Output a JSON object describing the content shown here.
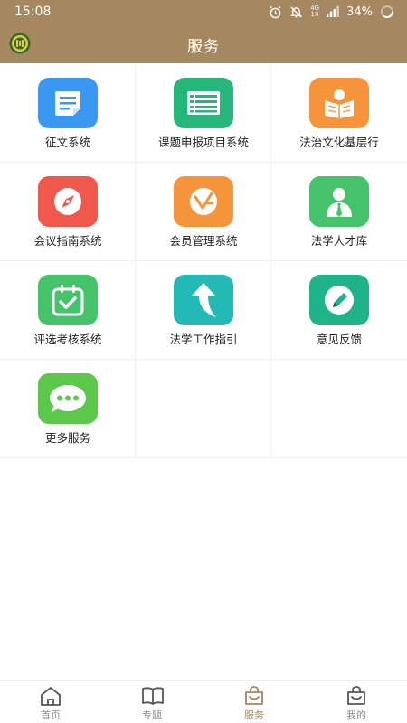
{
  "status": {
    "time": "15:08",
    "battery": "34%",
    "network_top": "4G",
    "network_bottom": "1X"
  },
  "header": {
    "title": "服务",
    "logo_icon": "emblem-logo-icon"
  },
  "colors": {
    "header": "#a58760",
    "tab_active": "#a58760",
    "tab_inactive": "#8a8a8a"
  },
  "services": [
    {
      "label": "征文系统",
      "icon": "document-icon",
      "color": "#3a97f2"
    },
    {
      "label": "课题申报项目系统",
      "icon": "list-icon",
      "color": "#25b67a"
    },
    {
      "label": "法治文化基层行",
      "icon": "reading-icon",
      "color": "#f5943a"
    },
    {
      "label": "会议指南系统",
      "icon": "compass-icon",
      "color": "#f0584b"
    },
    {
      "label": "会员管理系统",
      "icon": "member-icon",
      "color": "#f5943a"
    },
    {
      "label": "法学人才库",
      "icon": "person-icon",
      "color": "#45c36b"
    },
    {
      "label": "评选考核系统",
      "icon": "calendar-check-icon",
      "color": "#45c36b"
    },
    {
      "label": "法学工作指引",
      "icon": "arrow-up-icon",
      "color": "#23bab6"
    },
    {
      "label": "意见反馈",
      "icon": "pencil-icon",
      "color": "#1fb389"
    },
    {
      "label": "更多服务",
      "icon": "more-icon",
      "color": "#5cc84a"
    }
  ],
  "tabs": [
    {
      "label": "首页",
      "icon": "home-icon"
    },
    {
      "label": "专题",
      "icon": "book-icon"
    },
    {
      "label": "服务",
      "icon": "bag-icon",
      "active": true
    },
    {
      "label": "我的",
      "icon": "user-bag-icon"
    }
  ]
}
